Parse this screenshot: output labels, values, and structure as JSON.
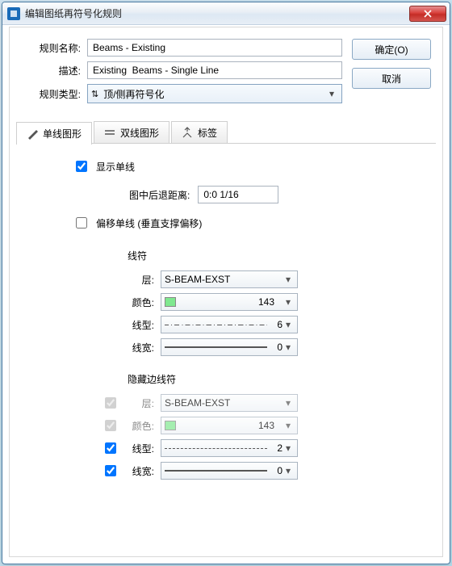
{
  "window": {
    "title": "编辑图纸再符号化规则"
  },
  "fields": {
    "name_label": "规则名称:",
    "name_value": "Beams - Existing",
    "desc_label": "描述:",
    "desc_value": "Existing  Beams - Single Line",
    "type_label": "规则类型:",
    "type_value": "顶/侧再符号化"
  },
  "buttons": {
    "ok": "确定(O)",
    "cancel": "取消"
  },
  "tabs": {
    "single": "单线图形",
    "double": "双线图形",
    "label": "标签"
  },
  "single": {
    "show_single": "显示单线",
    "setback_label": "图中后退距离:",
    "setback_value": "0:0 1/16",
    "offset_single": "偏移单线 (垂直支撑偏移)"
  },
  "linesym": {
    "title": "线符",
    "layer_label": "层:",
    "layer_value": "S-BEAM-EXST",
    "color_label": "颜色:",
    "color_value": "143",
    "linetype_label": "线型:",
    "linetype_value": "6",
    "lineweight_label": "线宽:",
    "lineweight_value": "0"
  },
  "hidden": {
    "title": "隐藏边线符",
    "layer_label": "层:",
    "layer_value": "S-BEAM-EXST",
    "color_label": "颜色:",
    "color_value": "143",
    "linetype_label": "线型:",
    "linetype_value": "2",
    "lineweight_label": "线宽:",
    "lineweight_value": "0"
  }
}
